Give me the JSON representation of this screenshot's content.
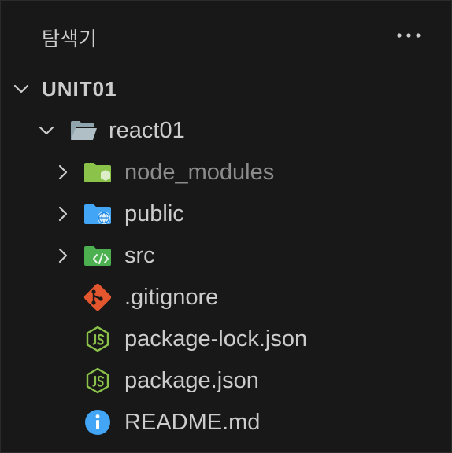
{
  "explorer": {
    "title": "탐색기",
    "more_icon": "ellipsis-icon"
  },
  "tree": {
    "root": {
      "label": "UNIT01",
      "expanded": true
    },
    "project": {
      "label": "react01",
      "expanded": true,
      "icon": "open-folder-icon"
    },
    "items": [
      {
        "label": "node_modules",
        "type": "folder",
        "icon": "node-modules-folder-icon",
        "dimmed": true
      },
      {
        "label": "public",
        "type": "folder",
        "icon": "public-folder-icon",
        "dimmed": false
      },
      {
        "label": "src",
        "type": "folder",
        "icon": "src-folder-icon",
        "dimmed": false
      },
      {
        "label": ".gitignore",
        "type": "file",
        "icon": "git-icon",
        "dimmed": false
      },
      {
        "label": "package-lock.json",
        "type": "file",
        "icon": "nodejs-icon",
        "dimmed": false
      },
      {
        "label": "package.json",
        "type": "file",
        "icon": "nodejs-icon",
        "dimmed": false
      },
      {
        "label": "README.md",
        "type": "file",
        "icon": "info-icon",
        "dimmed": false
      }
    ]
  },
  "colors": {
    "background": "#181818",
    "text": "#cccccc",
    "dimmed_text": "#8c8c8c",
    "folder_green": "#8bc34a",
    "folder_blue": "#42a5f5",
    "git_orange": "#e4572e",
    "node_green": "#8bc34a",
    "info_blue": "#42a5f5"
  }
}
